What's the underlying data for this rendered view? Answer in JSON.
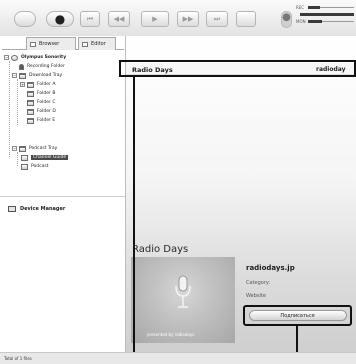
{
  "toolbar": {
    "buttons": [
      "record",
      "previous-track",
      "rewind",
      "play",
      "fast-forward",
      "next-track"
    ],
    "icons": {
      "record": "●",
      "prev": "⏮",
      "rew": "◀◀",
      "play": "▶",
      "ff": "▶▶",
      "next": "⏭"
    },
    "level_labels": {
      "rec": "REC",
      "mon": "MON"
    }
  },
  "tabs": {
    "browser": "Browser",
    "editor": "Editor"
  },
  "tree": {
    "root": "Olympus Sonority",
    "recording_folder": "Recording Folder",
    "download_tray": "Download Tray",
    "folders": [
      "Folder A",
      "Folder B",
      "Folder C",
      "Folder D",
      "Folder E"
    ],
    "podcast_tray": "Podcast Tray",
    "channel_guide": "Channel Guide",
    "podcast": "Podcast"
  },
  "device_manager": "Device Manager",
  "status_text": "Total of 1 files",
  "list": {
    "title": "Radio Days",
    "url": "radioday"
  },
  "guide": {
    "title": "Radio Days",
    "podcast_name": "radiodays.jp",
    "category_label": "Category:",
    "website_label": "Website",
    "art_caption": "presented by radiodays",
    "subscribe_label": "Подписаться"
  },
  "colors": {
    "selection": "#4a4a4a",
    "callout": "#111111"
  }
}
